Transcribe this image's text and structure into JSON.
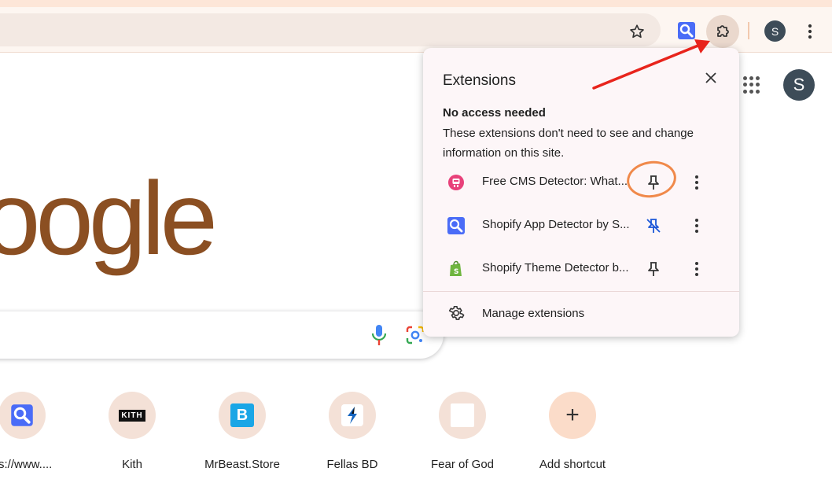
{
  "browser": {
    "profile_initial": "S"
  },
  "ntp": {
    "logo_text": "oogle",
    "profile_initial": "S",
    "shortcuts": [
      {
        "label": "ps://www...."
      },
      {
        "label": "Kith",
        "tile_text": "KITH"
      },
      {
        "label": "MrBeast.Store",
        "tile_text": "B"
      },
      {
        "label": "Fellas BD"
      },
      {
        "label": "Fear of God"
      },
      {
        "label": "Add shortcut",
        "tile_text": "+"
      }
    ]
  },
  "extensions_popup": {
    "title": "Extensions",
    "section_heading": "No access needed",
    "section_description": "These extensions don't need to see and change information on this site.",
    "items": [
      {
        "name": "Free CMS Detector: What...",
        "pinned": false,
        "icon": "cms-detector-icon",
        "icon_color": "#e8417a"
      },
      {
        "name": "Shopify App Detector by S...",
        "pinned": true,
        "icon": "magnifier-icon",
        "icon_color": "#4a6cf7"
      },
      {
        "name": "Shopify Theme Detector b...",
        "pinned": false,
        "icon": "shopify-bag-icon",
        "icon_color": "#6fb53f"
      }
    ],
    "manage_label": "Manage extensions"
  },
  "colors": {
    "logo": "#8b4f22",
    "annotation_arrow": "#e8241c",
    "annotation_circle": "#f0894a"
  }
}
